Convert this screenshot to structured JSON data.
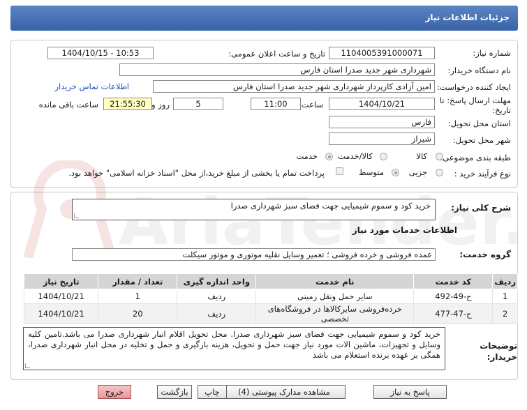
{
  "header": {
    "title": "جزئیات اطلاعات نیاز"
  },
  "form": {
    "need_number_label": "شماره نیاز:",
    "need_number": "1104005391000071",
    "announce_label": "تاریخ و ساعت اعلان عمومی:",
    "announce_value": "1404/10/15 - 10:53",
    "buyer_org_label": "نام دستگاه خریدار:",
    "buyer_org": "شهرداری شهر جدید صدرا استان فارس",
    "creator_label": "ایجاد کننده درخواست:",
    "creator": "امین آزادی کارپرداز شهرداری شهر جدید صدرا استان فارس",
    "contact_link": "اطلاعات تماس خریدار",
    "deadline_label": "مهلت ارسال پاسخ: تا تاریخ:",
    "deadline_date": "1404/10/21",
    "time_label": "ساعت",
    "deadline_time": "11:00",
    "days": "5",
    "days_label": "روز و",
    "remaining_time": "21:55:30",
    "remaining_label": "ساعت باقی مانده",
    "province_label": "استان محل تحویل:",
    "province": "فارس",
    "city_label": "شهر محل تحویل:",
    "city": "شیراز",
    "category_label": "طبقه بندی موضوعی:",
    "category_options": [
      "کالا",
      "کالا/خدمت",
      "خدمت"
    ],
    "category_selected": "خدمت",
    "process_label": "نوع فرآیند خرید :",
    "process_options": [
      "جزیی",
      "متوسط"
    ],
    "process_selected": "متوسط",
    "payment_note": "پرداخت تمام یا بخشی از مبلغ خرید،از محل \"اسناد خزانه اسلامی\" خواهد بود."
  },
  "details": {
    "summary_label": "شرح کلی نیاز:",
    "summary": "خرید کود و سموم شیمیایی جهت فضای سبز شهرداری صدرا",
    "services_title": "اطلاعات خدمات مورد نیاز",
    "group_label": "گروه خدمت:",
    "group": "عمده فروشی و خرده فروشی ؛ تعمیر وسایل نقلیه موتوری و موتور سیکلت"
  },
  "table": {
    "headers": [
      "ردیف",
      "کد خدمت",
      "نام خدمت",
      "واحد اندازه گیری",
      "تعداد / مقدار",
      "تاریخ نیاز"
    ],
    "rows": [
      [
        "1",
        "ح-49-492",
        "سایر حمل ونقل زمینی",
        "ردیف",
        "1",
        "1404/10/21"
      ],
      [
        "2",
        "ح-47-477",
        "خرده‌فروشی سایرکالاها در فروشگاه‌های تخصصی",
        "ردیف",
        "20",
        "1404/10/21"
      ]
    ]
  },
  "notes": {
    "label": "توضیحات خریدار:",
    "text": "خرید کود و سموم شیمیایی جهت فضای سبز شهرداری صدرا. محل تحویل اقلام انبار شهرداری صدرا می باشد.تامین کلیه وسایل و تجهیزات، ماشین الات مورد نیاز جهت حمل و تحویل، هزینه بارگیری و حمل و تخلیه در محل انبار شهرداری صدرا، همگی بر عهده برنده استعلام می باشد"
  },
  "buttons": {
    "reply": "پاسخ به نیاز",
    "attachments": "مشاهده مدارک پیوستی (4)",
    "print": "چاپ",
    "back": "بازگشت",
    "exit": "خروج"
  },
  "watermark": {
    "brand": "AriaTender.neT"
  },
  "colors": {
    "header": "#3a63a8",
    "link": "#1a4fb5",
    "remaining_bg": "#ffffc2",
    "exit_bg": "#e79a9a"
  }
}
